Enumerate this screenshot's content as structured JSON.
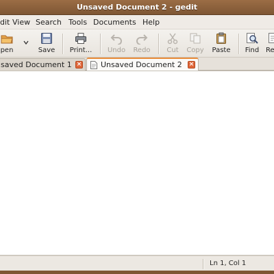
{
  "window": {
    "title": "Unsaved Document 2 - gedit"
  },
  "menubar": {
    "items": [
      {
        "label": "dit"
      },
      {
        "label": "View"
      },
      {
        "label": "Search"
      },
      {
        "label": "Tools"
      },
      {
        "label": "Documents"
      },
      {
        "label": "Help"
      }
    ]
  },
  "toolbar": {
    "open_label": "pen",
    "save_label": "Save",
    "print_label": "Print...",
    "undo_label": "Undo",
    "redo_label": "Redo",
    "cut_label": "Cut",
    "copy_label": "Copy",
    "paste_label": "Paste",
    "find_label": "Find",
    "replace_label": "Re"
  },
  "tabs": [
    {
      "label": "saved Document 1",
      "active": false
    },
    {
      "label": "Unsaved Document 2",
      "active": true
    }
  ],
  "editor": {
    "content": ""
  },
  "statusbar": {
    "position": "Ln 1, Col 1"
  },
  "colors": {
    "titlebar": "#8d6340",
    "tab_close": "#e0673a",
    "active_tab_accent": "#e98b39"
  },
  "icons": {
    "open": "folder-open-icon",
    "save": "floppy-disk-icon",
    "print": "printer-icon",
    "undo": "undo-arrow-icon",
    "redo": "redo-arrow-icon",
    "cut": "scissors-icon",
    "copy": "copy-icon",
    "paste": "clipboard-icon",
    "find": "magnifier-icon",
    "tab_close": "close-x-icon",
    "tab_doc": "document-icon"
  }
}
